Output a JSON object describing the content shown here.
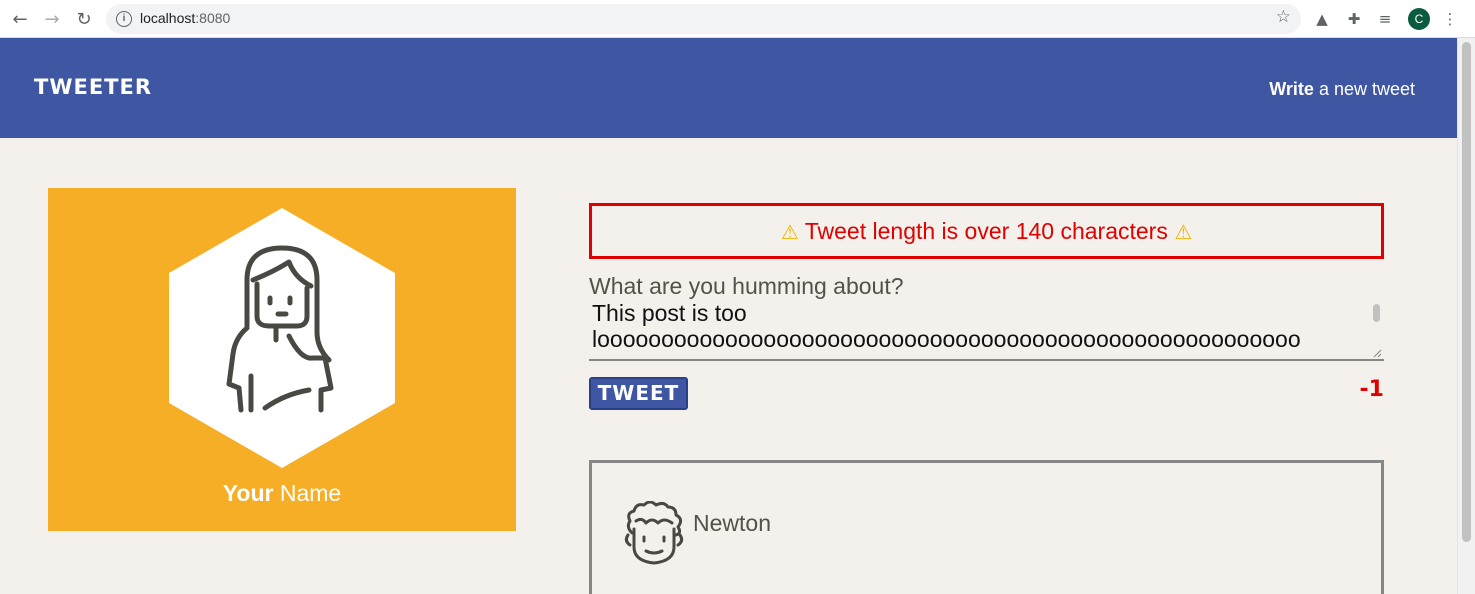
{
  "browser": {
    "url_host": "localhost",
    "url_port": ":8080",
    "profile_initial": "C"
  },
  "header": {
    "brand": "TWEETER",
    "write_bold": "Write",
    "write_rest": " a new tweet"
  },
  "profile": {
    "name_bold": "Your",
    "name_rest": " Name"
  },
  "compose": {
    "error": "Tweet length is over 140 characters",
    "label": "What are you humming about?",
    "text_line1": "This post is too",
    "text_line2": "looooooooooooooooooooooooooooooooooooooooooooooooooooooo",
    "button": "TWEET",
    "counter": "-1"
  },
  "tweets": [
    {
      "author": "Newton"
    }
  ],
  "colors": {
    "header": "#3f56a2",
    "profile": "#f6ae26",
    "error": "#e00000",
    "background": "#f4f1ec"
  }
}
